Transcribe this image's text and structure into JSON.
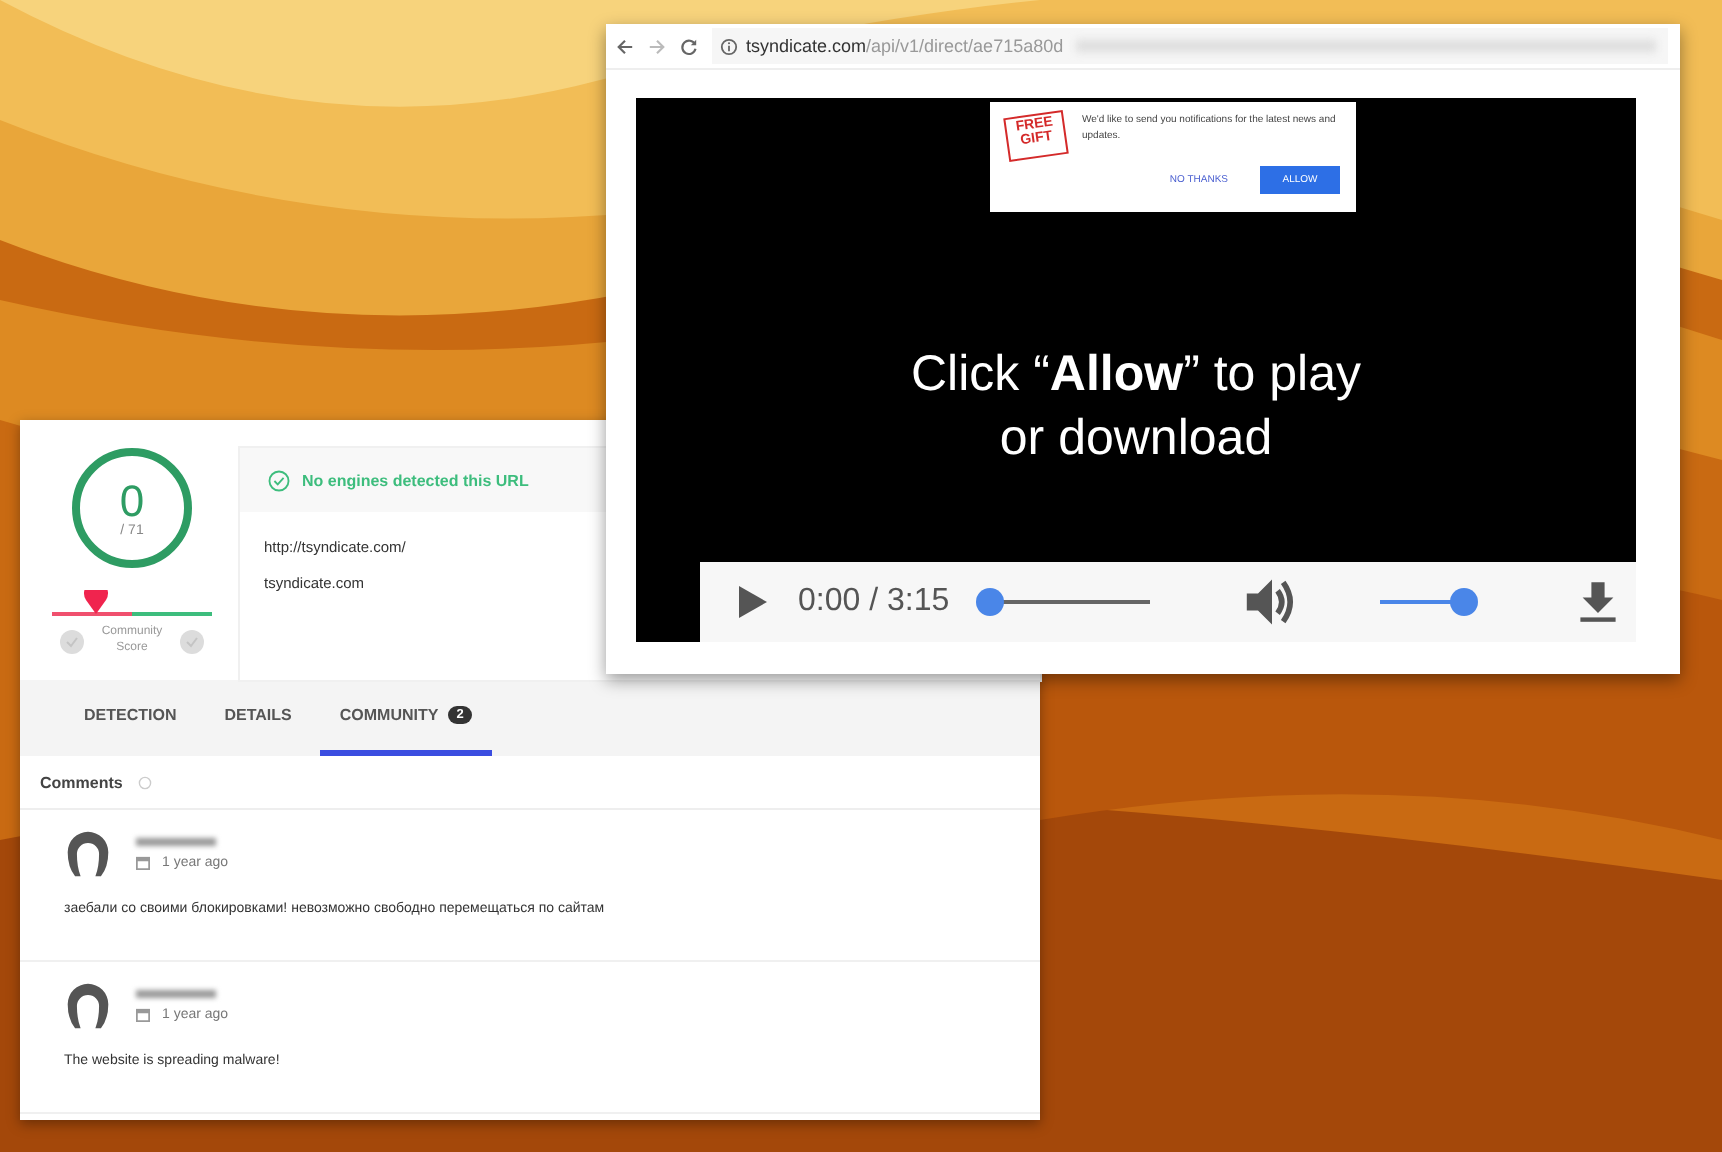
{
  "browser": {
    "url_host": "tsyndicate.com",
    "url_path": "/api/v1/direct/ae715a80d"
  },
  "notification": {
    "badge_lines": [
      "FREE",
      "GIFT"
    ],
    "message": "We'd like to send you notifications for the latest news and updates.",
    "buttons": [
      {
        "label": "NO THANKS",
        "kind": "secondary"
      },
      {
        "label": "ALLOW",
        "kind": "primary"
      }
    ]
  },
  "video": {
    "overlay_lines": [
      "Click “**Allow**” to play",
      "or download"
    ],
    "time": "0:00 / 3:15",
    "progress": {
      "level": 0
    },
    "volume": {
      "level": 1
    }
  },
  "report": {
    "score": "0",
    "total": "/ 71",
    "community_label": "Community Score",
    "status": "No engines detected this URL",
    "url": "http://tsyndicate.com/",
    "domain": "tsyndicate.com",
    "tabs": [
      {
        "label": "DETECTION",
        "selected": false
      },
      {
        "label": "DETAILS",
        "selected": false
      },
      {
        "label": "COMMUNITY",
        "badge": "2",
        "selected": true
      }
    ],
    "comments_title": "Comments",
    "comments": [
      {
        "date": "1 year ago",
        "text": "заебали со своими блокировками! невозможно свободно перемещаться по сайтам"
      },
      {
        "date": "1 year ago",
        "text": "The website is spreading malware!"
      }
    ]
  }
}
